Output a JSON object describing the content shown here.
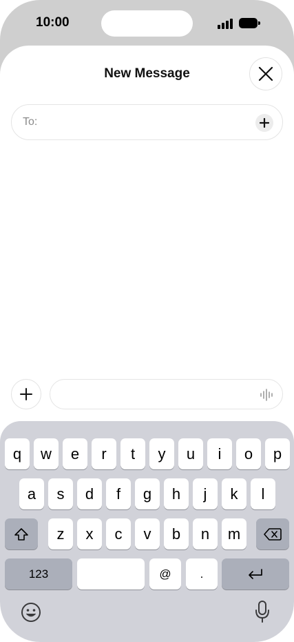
{
  "status": {
    "time": "10:00"
  },
  "sheet": {
    "title": "New Message",
    "to_label": "To:"
  },
  "keyboard": {
    "row1": [
      "q",
      "w",
      "e",
      "r",
      "t",
      "y",
      "u",
      "i",
      "o",
      "p"
    ],
    "row2": [
      "a",
      "s",
      "d",
      "f",
      "g",
      "h",
      "j",
      "k",
      "l"
    ],
    "row3": [
      "z",
      "x",
      "c",
      "v",
      "b",
      "n",
      "m"
    ],
    "numbers_label": "123",
    "at_label": "@",
    "period_label": "."
  },
  "colors": {
    "keyboard_bg": "#d1d2d9",
    "frame": "#cfcfcf",
    "key": "#ffffff"
  },
  "icons": [
    "close-icon",
    "plus-icon",
    "waveform-icon",
    "shift-icon",
    "backspace-icon",
    "return-icon",
    "emoji-icon",
    "microphone-icon"
  ]
}
